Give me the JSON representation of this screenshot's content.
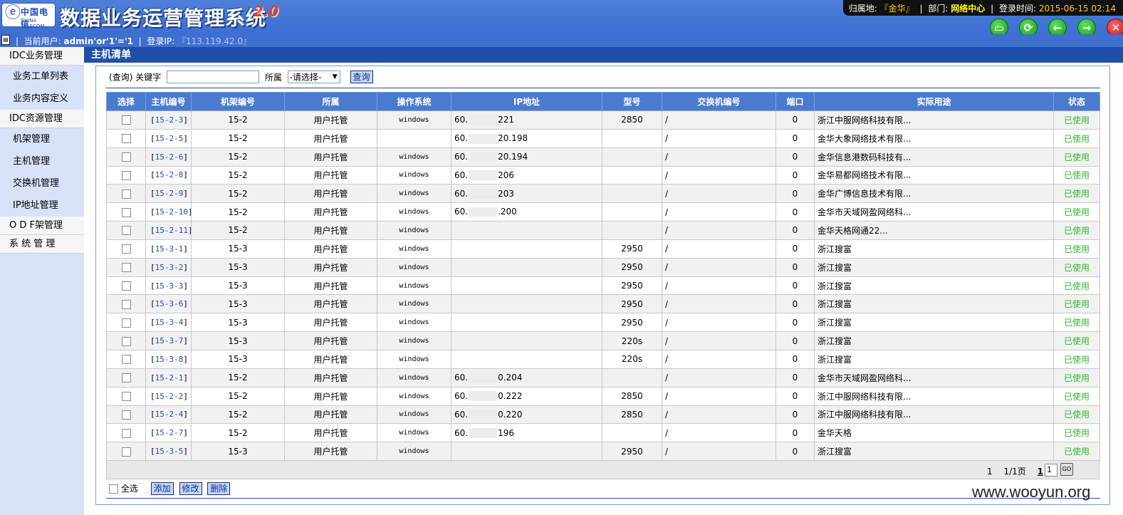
{
  "header": {
    "logo_cn": "中国电信",
    "logo_en": "CHINA TELECOM",
    "title": "数据业务运营管理系统",
    "version": "2.0",
    "location_label": "归属地:",
    "location_value": "『金华』",
    "dept_label": "部门:",
    "dept_value": "网络中心",
    "login_time_label": "登录时间:",
    "login_time_value": "2015-06-15 02:14"
  },
  "userbar": {
    "current_user_label": "当前用户:",
    "current_user": "admin'or'1'='1",
    "login_ip_label": "登录IP:",
    "login_ip": "『113.119.42.0』"
  },
  "sidebar": {
    "groups": [
      {
        "label": "IDC业务管理",
        "items": [
          "业务工单列表",
          "业务内容定义"
        ]
      },
      {
        "label": "IDC资源管理",
        "items": [
          "机架管理",
          "主机管理",
          "交换机管理",
          "IP地址管理"
        ]
      },
      {
        "label": "O D F架管理",
        "items": []
      },
      {
        "label": "系 统 管 理",
        "items": []
      }
    ]
  },
  "content_title": "主机清单",
  "search": {
    "prefix": "(查询)",
    "keyword_label": "关键字",
    "keyword_value": "",
    "owner_label": "所属",
    "owner_selected": "-请选择-",
    "query_button": "查询"
  },
  "table": {
    "columns": [
      "选择",
      "主机编号",
      "机架编号",
      "所属",
      "操作系统",
      "IP地址",
      "型号",
      "交换机编号",
      "端口",
      "实际用途",
      "状态"
    ],
    "rows": [
      {
        "host": "15-2-3",
        "rack": "15-2",
        "owner": "用户托管",
        "os": "windows",
        "ip_prefix": "60.",
        "ip_suffix": "221",
        "model": "2850",
        "switch": "/",
        "port": "0",
        "usage": "浙江中服网络科技有限...",
        "status": "已使用"
      },
      {
        "host": "15-2-5",
        "rack": "15-2",
        "owner": "用户托管",
        "os": "",
        "ip_prefix": "60.",
        "ip_suffix": "20.198",
        "model": "",
        "switch": "/",
        "port": "0",
        "usage": "金华大象网络技术有限...",
        "status": "已使用"
      },
      {
        "host": "15-2-6",
        "rack": "15-2",
        "owner": "用户托管",
        "os": "windows",
        "ip_prefix": "60.",
        "ip_suffix": "20.194",
        "model": "",
        "switch": "/",
        "port": "0",
        "usage": "金华信息港数码科技有...",
        "status": "已使用"
      },
      {
        "host": "15-2-8",
        "rack": "15-2",
        "owner": "用户托管",
        "os": "windows",
        "ip_prefix": "60.",
        "ip_suffix": "206",
        "model": "",
        "switch": "/",
        "port": "0",
        "usage": "金华易都网络技术有限...",
        "status": "已使用"
      },
      {
        "host": "15-2-9",
        "rack": "15-2",
        "owner": "用户托管",
        "os": "windows",
        "ip_prefix": "60.",
        "ip_suffix": "203",
        "model": "",
        "switch": "/",
        "port": "0",
        "usage": "金华广博信息技术有限...",
        "status": "已使用"
      },
      {
        "host": "15-2-10",
        "rack": "15-2",
        "owner": "用户托管",
        "os": "windows",
        "ip_prefix": "60.",
        "ip_suffix": ".200",
        "model": "",
        "switch": "/",
        "port": "0",
        "usage": "金华市天域网盈网络科...",
        "status": "已使用"
      },
      {
        "host": "15-2-11",
        "rack": "15-2",
        "owner": "用户托管",
        "os": "windows",
        "ip_prefix": "",
        "ip_suffix": "",
        "model": "",
        "switch": "/",
        "port": "0",
        "usage": "金华天格网通22...",
        "status": "已使用"
      },
      {
        "host": "15-3-1",
        "rack": "15-3",
        "owner": "用户托管",
        "os": "windows",
        "ip_prefix": "",
        "ip_suffix": "",
        "model": "2950",
        "switch": "/",
        "port": "0",
        "usage": "浙江搜富",
        "status": "已使用"
      },
      {
        "host": "15-3-2",
        "rack": "15-3",
        "owner": "用户托管",
        "os": "windows",
        "ip_prefix": "",
        "ip_suffix": "",
        "model": "2950",
        "switch": "/",
        "port": "0",
        "usage": "浙江搜富",
        "status": "已使用"
      },
      {
        "host": "15-3-3",
        "rack": "15-3",
        "owner": "用户托管",
        "os": "windows",
        "ip_prefix": "",
        "ip_suffix": "",
        "model": "2950",
        "switch": "/",
        "port": "0",
        "usage": "浙江搜富",
        "status": "已使用"
      },
      {
        "host": "15-3-6",
        "rack": "15-3",
        "owner": "用户托管",
        "os": "windows",
        "ip_prefix": "",
        "ip_suffix": "",
        "model": "2950",
        "switch": "/",
        "port": "0",
        "usage": "浙江搜富",
        "status": "已使用"
      },
      {
        "host": "15-3-4",
        "rack": "15-3",
        "owner": "用户托管",
        "os": "windows",
        "ip_prefix": "",
        "ip_suffix": "",
        "model": "2950",
        "switch": "/",
        "port": "0",
        "usage": "浙江搜富",
        "status": "已使用"
      },
      {
        "host": "15-3-7",
        "rack": "15-3",
        "owner": "用户托管",
        "os": "windows",
        "ip_prefix": "",
        "ip_suffix": "",
        "model": "220s",
        "switch": "/",
        "port": "0",
        "usage": "浙江搜富",
        "status": "已使用"
      },
      {
        "host": "15-3-8",
        "rack": "15-3",
        "owner": "用户托管",
        "os": "windows",
        "ip_prefix": "",
        "ip_suffix": "",
        "model": "220s",
        "switch": "/",
        "port": "0",
        "usage": "浙江搜富",
        "status": "已使用"
      },
      {
        "host": "15-2-1",
        "rack": "15-2",
        "owner": "用户托管",
        "os": "windows",
        "ip_prefix": "60.",
        "ip_suffix": "0.204",
        "model": "",
        "switch": "/",
        "port": "0",
        "usage": "金华市天域网盈网络科...",
        "status": "已使用"
      },
      {
        "host": "15-2-2",
        "rack": "15-2",
        "owner": "用户托管",
        "os": "windows",
        "ip_prefix": "60.",
        "ip_suffix": "0.222",
        "model": "2850",
        "switch": "/",
        "port": "0",
        "usage": "浙江中服网络科技有限...",
        "status": "已使用"
      },
      {
        "host": "15-2-4",
        "rack": "15-2",
        "owner": "用户托管",
        "os": "windows",
        "ip_prefix": "60.",
        "ip_suffix": "0.220",
        "model": "2850",
        "switch": "/",
        "port": "0",
        "usage": "浙江中服网络科技有限...",
        "status": "已使用"
      },
      {
        "host": "15-2-7",
        "rack": "15-2",
        "owner": "用户托管",
        "os": "windows",
        "ip_prefix": "60.",
        "ip_suffix": "196",
        "model": "",
        "switch": "/",
        "port": "0",
        "usage": "金华天格",
        "status": "已使用"
      },
      {
        "host": "15-3-5",
        "rack": "15-3",
        "owner": "用户托管",
        "os": "windows",
        "ip_prefix": "",
        "ip_suffix": "",
        "model": "2950",
        "switch": "/",
        "port": "0",
        "usage": "浙江搜富",
        "status": "已使用"
      }
    ]
  },
  "pager": {
    "total": "1",
    "page_of": "1/1页",
    "current": "1",
    "input_value": "1",
    "go": "GO"
  },
  "actions": {
    "select_all": "全选",
    "add": "添加",
    "edit": "修改",
    "delete": "删除"
  },
  "watermark": "www.wooyun.org",
  "colors": {
    "status_green": "#2db82d",
    "header_blue": "#4a7bcf",
    "title_bar": "#1f4ea8"
  }
}
